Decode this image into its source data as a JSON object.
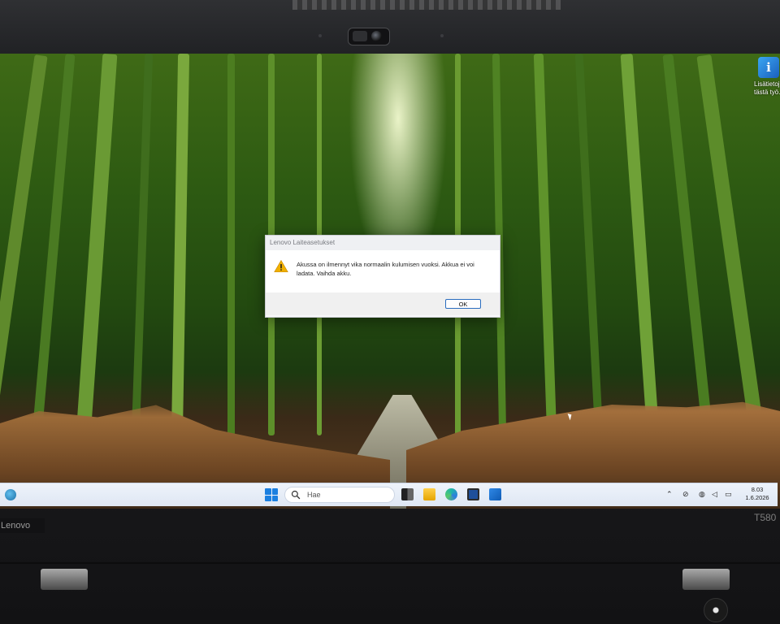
{
  "desktop": {
    "icon": {
      "name": "info-icon",
      "label_line1": "Lisätietoj",
      "label_line2": "tästä työ..."
    }
  },
  "dialog": {
    "title": "Lenovo Laiteasetukset",
    "message": "Akussa on ilmennyt vika normaalin kulumisen vuoksi. Akkua ei voi ladata. Vaihda akku.",
    "ok_label": "OK"
  },
  "taskbar": {
    "search_placeholder": "Hae",
    "clock_time": "8.03",
    "clock_date": "1.6.2026"
  },
  "laptop": {
    "brand": "Lenovo",
    "model": "T580"
  },
  "colors": {
    "accent": "#1a7fe0",
    "warning": "#f0b000",
    "dialog_bg": "#ffffff"
  }
}
